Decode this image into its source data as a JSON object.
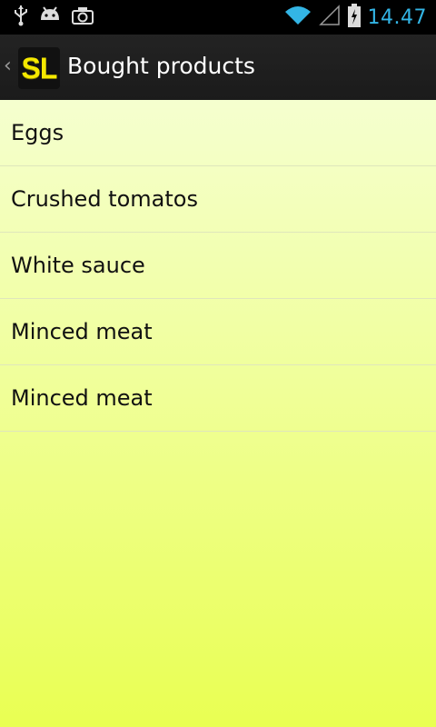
{
  "status_bar": {
    "time": "14.47",
    "accent_color": "#33b5e5",
    "icons_left": [
      "usb-icon",
      "android-debug-icon",
      "camera-icon"
    ],
    "icons_right": [
      "wifi-icon",
      "signal-icon",
      "battery-charging-icon"
    ]
  },
  "action_bar": {
    "logo_text": "SL",
    "title": "Bought products"
  },
  "products": [
    {
      "label": "Eggs"
    },
    {
      "label": "Crushed tomatos"
    },
    {
      "label": "White sauce"
    },
    {
      "label": "Minced meat"
    },
    {
      "label": "Minced meat"
    }
  ],
  "colors": {
    "list_background_top": "#f5ffcf",
    "list_background_bottom": "#e9ff52",
    "logo_yellow": "#f4e800"
  }
}
